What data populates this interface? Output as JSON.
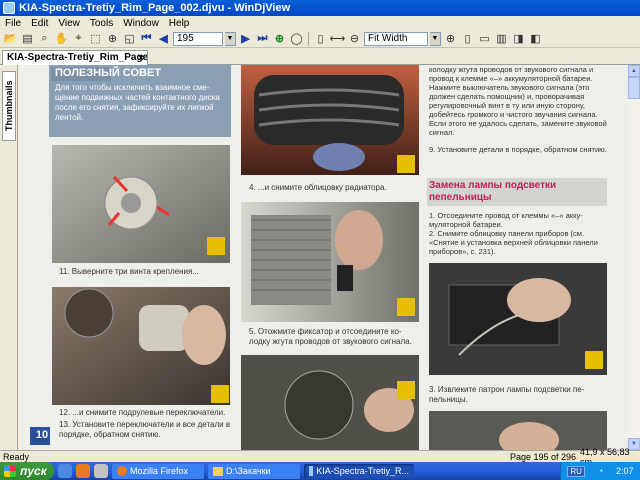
{
  "window": {
    "title": "KIA-Spectra-Tretiy_Rim_Page_002.djvu - WinDjView"
  },
  "menu": [
    "File",
    "Edit",
    "View",
    "Tools",
    "Window",
    "Help"
  ],
  "toolbar": {
    "page_number": "195",
    "zoom": "Fit Width"
  },
  "tab": {
    "label": "KIA-Spectra-Tretiy_Rim_Page_002....",
    "close": "×"
  },
  "sidebar": {
    "thumbnails_label": "Thumbnails"
  },
  "page": {
    "tip_heading": "ПОЛЕЗНЫЙ СОВЕТ",
    "tip_text": "Для того чтобы исключить взаимное сме-щение подвижных частей контактного диска после его снятия, зафиксируйте их липкой лентой.",
    "cap_11": "11. Выверните три винта крепления...",
    "cap_12": "12. ...и снимите подрулевые переключатели.",
    "cap_13": "13. Установите переключатели и все детали в порядке, обратном снятию.",
    "cap_4": "4. ...и снимите облицовку радиатора.",
    "cap_5": "5. Отожмите фиксатор и отсоедините ко-лодку жгута проводов от звукового сигнала.",
    "col3_top": "колодку жгута проводов от звукового сигнала и провод к клемме «–» аккумуляторной батареи. Нажмите выключатель звукового сигнала (это должен сделать помощник) и, проворачивая регулировочный винт в ту или иную сторону, добейтесь громкого и чистого звучания сигнала. Если этого не удалось сделать, замените звуковой сигнал.",
    "col3_step9": "9. Установите детали в порядке, обратном снятию.",
    "section_heading": "Замена лампы подсветки пепельницы",
    "step1": "1. Отсоедините провод от клеммы «–» акку-муляторной батареи.",
    "step2": "2. Снимите облицовку панели приборов (см. «Снятие и установка верхней облицовки панели приборов», с. 231).",
    "cap_3": "3. Извлеките патрон лампы подсветки пе-пельницы.",
    "page_num": "10"
  },
  "status": {
    "left": "Ready",
    "page_info": "Page 195 of 296",
    "size": "41,9 x 56,83 cm"
  },
  "taskbar": {
    "start": "пуск",
    "tasks": [
      "Mozilla Firefox",
      "D:\\Закачки",
      "KIA-Spectra-Tretiy_R..."
    ],
    "lang": "RU",
    "clock": "2:07"
  },
  "colors": {
    "heading_red": "#c0205a",
    "tip_bg": "#8a9fb4"
  }
}
